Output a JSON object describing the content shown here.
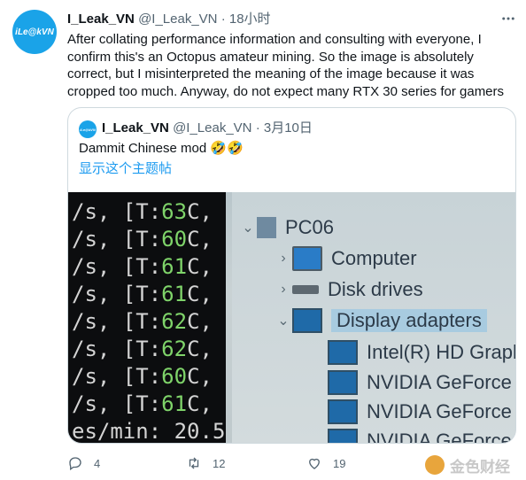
{
  "tweet": {
    "avatar_text": "iLe@kVN",
    "display_name": "I_Leak_VN",
    "handle": "@I_Leak_VN",
    "separator": "·",
    "time": "18小时",
    "text": "After collating performance information and consulting with everyone, I confirm this's an Octopus amateur mining. So the image is absolutely correct, but I misinterpreted the meaning of the image because it was cropped too much. Anyway, do not expect many RTX 30 series for gamers",
    "more_icon": "more-horizontal-icon"
  },
  "quoted": {
    "avatar_text": "iLe@kVN",
    "display_name": "I_Leak_VN",
    "handle": "@I_Leak_VN",
    "separator": "·",
    "date": "3月10日",
    "text": "Dammit Chinese mod 🤣🤣",
    "show_thread": "显示这个主题帖",
    "image": {
      "terminal_lines": [
        {
          "prefix": "/s, [T:",
          "temp": "63",
          "suffix": "C,"
        },
        {
          "prefix": "/s, [T:",
          "temp": "60",
          "suffix": "C,"
        },
        {
          "prefix": "/s, [T:",
          "temp": "61",
          "suffix": "C,"
        },
        {
          "prefix": "/s, [T:",
          "temp": "61",
          "suffix": "C,"
        },
        {
          "prefix": "/s, [T:",
          "temp": "62",
          "suffix": "C,"
        },
        {
          "prefix": "/s, [T:",
          "temp": "62",
          "suffix": "C,"
        },
        {
          "prefix": "/s, [T:",
          "temp": "60",
          "suffix": "C,"
        },
        {
          "prefix": "/s, [T:",
          "temp": "61",
          "suffix": "C,"
        },
        {
          "prefix": "es/min: 20.5",
          "temp": "",
          "suffix": ""
        }
      ],
      "tree": {
        "root": "PC06",
        "computer": "Computer",
        "disk_drives": "Disk drives",
        "display_adapters": "Display adapters",
        "adapters": [
          "Intel(R) HD Graphi",
          "NVIDIA GeForce R",
          "NVIDIA GeForce R",
          "NVIDIA GeForce"
        ]
      }
    }
  },
  "actions": {
    "reply_count": "4",
    "retweet_count": "12",
    "like_count": "19"
  },
  "watermark": {
    "text": "金色财经"
  }
}
